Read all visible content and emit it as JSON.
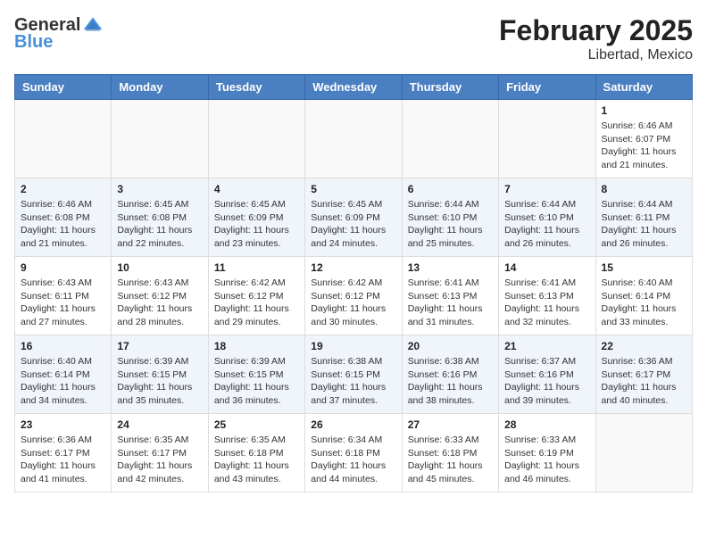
{
  "logo": {
    "general": "General",
    "blue": "Blue"
  },
  "title": {
    "month_year": "February 2025",
    "location": "Libertad, Mexico"
  },
  "weekdays": [
    "Sunday",
    "Monday",
    "Tuesday",
    "Wednesday",
    "Thursday",
    "Friday",
    "Saturday"
  ],
  "weeks": [
    [
      {
        "day": "",
        "info": ""
      },
      {
        "day": "",
        "info": ""
      },
      {
        "day": "",
        "info": ""
      },
      {
        "day": "",
        "info": ""
      },
      {
        "day": "",
        "info": ""
      },
      {
        "day": "",
        "info": ""
      },
      {
        "day": "1",
        "info": "Sunrise: 6:46 AM\nSunset: 6:07 PM\nDaylight: 11 hours\nand 21 minutes."
      }
    ],
    [
      {
        "day": "2",
        "info": "Sunrise: 6:46 AM\nSunset: 6:08 PM\nDaylight: 11 hours\nand 21 minutes."
      },
      {
        "day": "3",
        "info": "Sunrise: 6:45 AM\nSunset: 6:08 PM\nDaylight: 11 hours\nand 22 minutes."
      },
      {
        "day": "4",
        "info": "Sunrise: 6:45 AM\nSunset: 6:09 PM\nDaylight: 11 hours\nand 23 minutes."
      },
      {
        "day": "5",
        "info": "Sunrise: 6:45 AM\nSunset: 6:09 PM\nDaylight: 11 hours\nand 24 minutes."
      },
      {
        "day": "6",
        "info": "Sunrise: 6:44 AM\nSunset: 6:10 PM\nDaylight: 11 hours\nand 25 minutes."
      },
      {
        "day": "7",
        "info": "Sunrise: 6:44 AM\nSunset: 6:10 PM\nDaylight: 11 hours\nand 26 minutes."
      },
      {
        "day": "8",
        "info": "Sunrise: 6:44 AM\nSunset: 6:11 PM\nDaylight: 11 hours\nand 26 minutes."
      }
    ],
    [
      {
        "day": "9",
        "info": "Sunrise: 6:43 AM\nSunset: 6:11 PM\nDaylight: 11 hours\nand 27 minutes."
      },
      {
        "day": "10",
        "info": "Sunrise: 6:43 AM\nSunset: 6:12 PM\nDaylight: 11 hours\nand 28 minutes."
      },
      {
        "day": "11",
        "info": "Sunrise: 6:42 AM\nSunset: 6:12 PM\nDaylight: 11 hours\nand 29 minutes."
      },
      {
        "day": "12",
        "info": "Sunrise: 6:42 AM\nSunset: 6:12 PM\nDaylight: 11 hours\nand 30 minutes."
      },
      {
        "day": "13",
        "info": "Sunrise: 6:41 AM\nSunset: 6:13 PM\nDaylight: 11 hours\nand 31 minutes."
      },
      {
        "day": "14",
        "info": "Sunrise: 6:41 AM\nSunset: 6:13 PM\nDaylight: 11 hours\nand 32 minutes."
      },
      {
        "day": "15",
        "info": "Sunrise: 6:40 AM\nSunset: 6:14 PM\nDaylight: 11 hours\nand 33 minutes."
      }
    ],
    [
      {
        "day": "16",
        "info": "Sunrise: 6:40 AM\nSunset: 6:14 PM\nDaylight: 11 hours\nand 34 minutes."
      },
      {
        "day": "17",
        "info": "Sunrise: 6:39 AM\nSunset: 6:15 PM\nDaylight: 11 hours\nand 35 minutes."
      },
      {
        "day": "18",
        "info": "Sunrise: 6:39 AM\nSunset: 6:15 PM\nDaylight: 11 hours\nand 36 minutes."
      },
      {
        "day": "19",
        "info": "Sunrise: 6:38 AM\nSunset: 6:15 PM\nDaylight: 11 hours\nand 37 minutes."
      },
      {
        "day": "20",
        "info": "Sunrise: 6:38 AM\nSunset: 6:16 PM\nDaylight: 11 hours\nand 38 minutes."
      },
      {
        "day": "21",
        "info": "Sunrise: 6:37 AM\nSunset: 6:16 PM\nDaylight: 11 hours\nand 39 minutes."
      },
      {
        "day": "22",
        "info": "Sunrise: 6:36 AM\nSunset: 6:17 PM\nDaylight: 11 hours\nand 40 minutes."
      }
    ],
    [
      {
        "day": "23",
        "info": "Sunrise: 6:36 AM\nSunset: 6:17 PM\nDaylight: 11 hours\nand 41 minutes."
      },
      {
        "day": "24",
        "info": "Sunrise: 6:35 AM\nSunset: 6:17 PM\nDaylight: 11 hours\nand 42 minutes."
      },
      {
        "day": "25",
        "info": "Sunrise: 6:35 AM\nSunset: 6:18 PM\nDaylight: 11 hours\nand 43 minutes."
      },
      {
        "day": "26",
        "info": "Sunrise: 6:34 AM\nSunset: 6:18 PM\nDaylight: 11 hours\nand 44 minutes."
      },
      {
        "day": "27",
        "info": "Sunrise: 6:33 AM\nSunset: 6:18 PM\nDaylight: 11 hours\nand 45 minutes."
      },
      {
        "day": "28",
        "info": "Sunrise: 6:33 AM\nSunset: 6:19 PM\nDaylight: 11 hours\nand 46 minutes."
      },
      {
        "day": "",
        "info": ""
      }
    ]
  ]
}
